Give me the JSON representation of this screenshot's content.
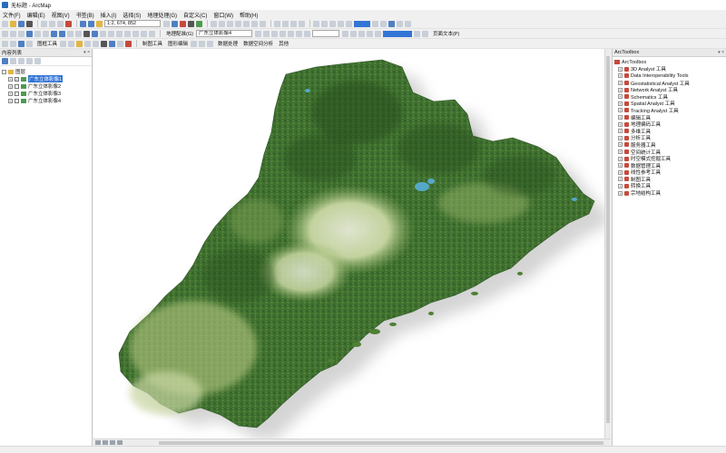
{
  "window": {
    "title": "无标题 - ArcMap"
  },
  "menu": [
    "文件(F)",
    "编辑(E)",
    "视图(V)",
    "书签(B)",
    "插入(I)",
    "选择(S)",
    "地理处理(G)",
    "自定义(C)",
    "窗口(W)",
    "帮助(H)"
  ],
  "toolbar": {
    "scale_value": "1:2, 674, 852",
    "georef_label": "地理配准(G)",
    "georef_layer": "广东立体影像4",
    "page_text_label": "页面文本(P)",
    "drawing_label": "图框工具",
    "draw_tools_label": "制图工具",
    "graph_label": "图形编辑",
    "data_processing_label": "数据处理",
    "data_spatial_label": "数据空间分析",
    "other_label": "其他",
    "accent_color": "#3375d6"
  },
  "toc": {
    "title": "内容列表",
    "root": "图层",
    "layers": [
      {
        "label": "广东立体影像1",
        "checked": true,
        "selected": true
      },
      {
        "label": "广东立体影像2",
        "checked": false,
        "selected": false
      },
      {
        "label": "广东立体影像3",
        "checked": false,
        "selected": false
      },
      {
        "label": "广东立体影像4",
        "checked": false,
        "selected": false
      }
    ]
  },
  "toolbox": {
    "title": "ArcToolbox",
    "root": "ArcToolbox",
    "items": [
      "3D Analyst 工具",
      "Data Interoperability Tools",
      "Geostatistical Analyst 工具",
      "Network Analyst 工具",
      "Schematics 工具",
      "Spatial Analyst 工具",
      "Tracking Analyst 工具",
      "编辑工具",
      "地理编码工具",
      "多维工具",
      "分析工具",
      "服务器工具",
      "空间统计工具",
      "时空模式挖掘工具",
      "数据管理工具",
      "线性参考工具",
      "制图工具",
      "转换工具",
      "宗地结构工具"
    ]
  },
  "map": {
    "colors": {
      "forest_dark": "#2f5f26",
      "forest": "#4f7f33",
      "lowland": "#c9d7a3",
      "urban": "#e7ead7",
      "water": "#55a8c8",
      "shadow": "#e0e0e0"
    }
  }
}
